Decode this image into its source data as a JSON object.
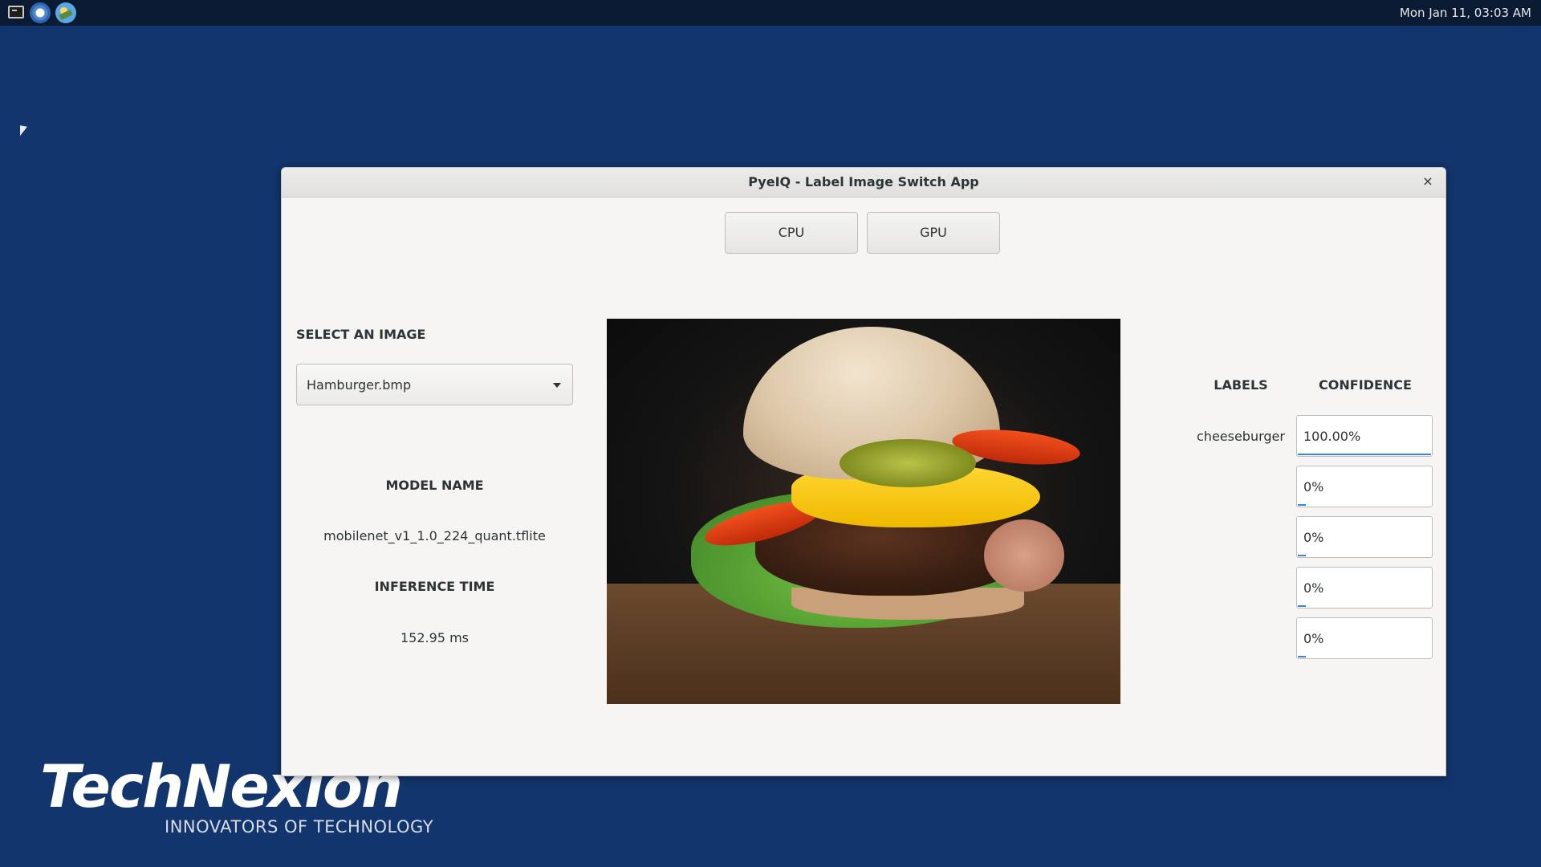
{
  "topbar": {
    "clock": "Mon Jan 11, 03:03 AM",
    "icons": [
      "terminal-icon",
      "browser-icon",
      "image-viewer-icon"
    ]
  },
  "logo": {
    "name": "TechNexion",
    "tagline": "INNOVATORS OF TECHNOLOGY"
  },
  "window": {
    "title": "PyeIQ - Label Image Switch App",
    "close_label": "×",
    "buttons": {
      "cpu": "CPU",
      "gpu": "GPU"
    },
    "select_label": "SELECT AN IMAGE",
    "selected_image": "Hamburger.bmp",
    "model_name_title": "MODEL NAME",
    "model_name": "mobilenet_v1_1.0_224_quant.tflite",
    "inference_time_title": "INFERENCE TIME",
    "inference_time": "152.95 ms",
    "labels_title": "LABELS",
    "confidence_title": "CONFIDENCE",
    "results": [
      {
        "label": "cheeseburger",
        "confidence": "100.00%",
        "level": 1.0
      },
      {
        "label": "",
        "confidence": "0%",
        "level": 0.0
      },
      {
        "label": "",
        "confidence": "0%",
        "level": 0.0
      },
      {
        "label": "",
        "confidence": "0%",
        "level": 0.0
      },
      {
        "label": "",
        "confidence": "0%",
        "level": 0.0
      }
    ]
  },
  "colors": {
    "desktop": "#12356d",
    "accent": "#3584e4"
  }
}
